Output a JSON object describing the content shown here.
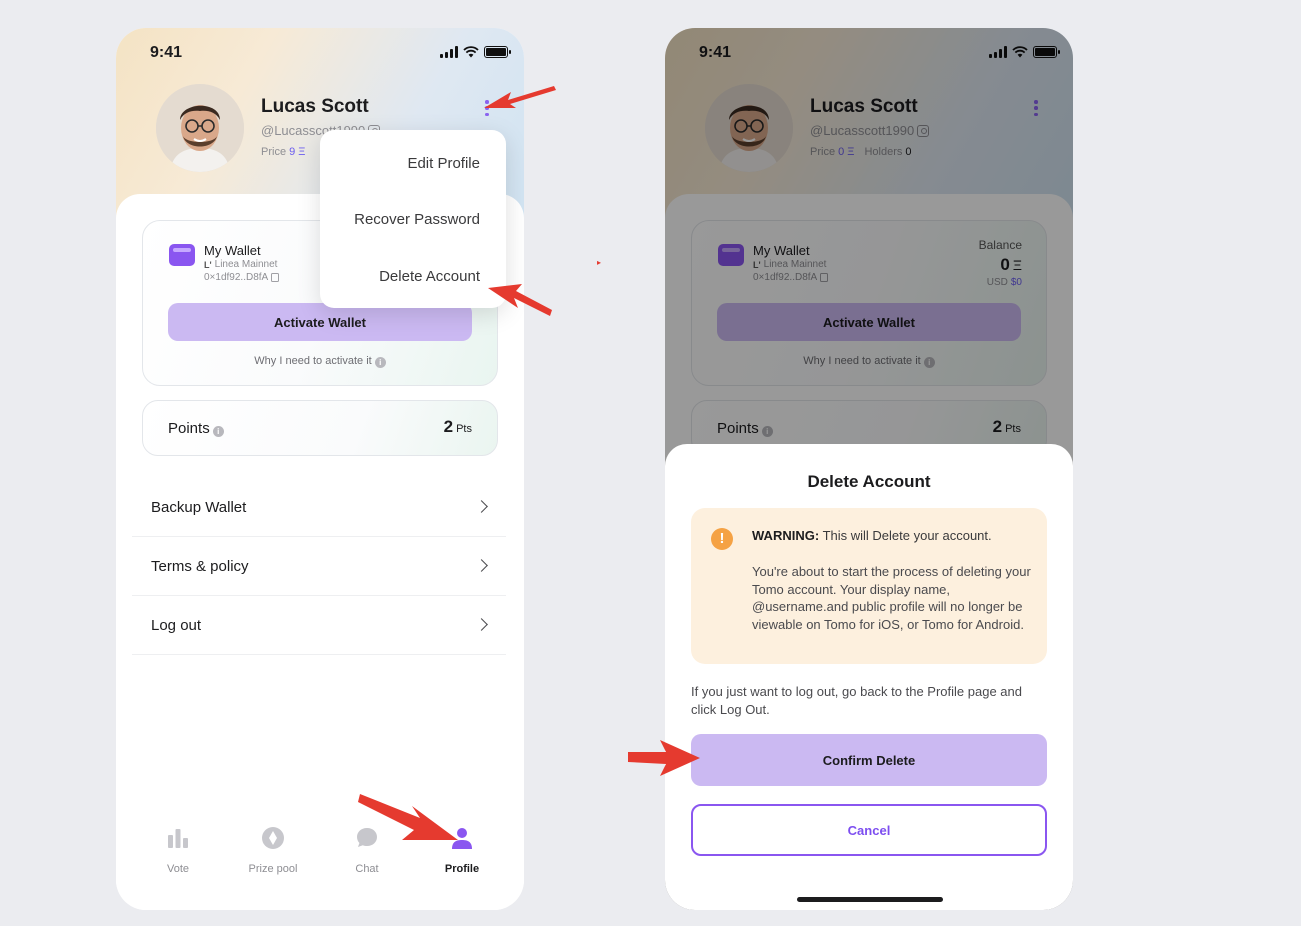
{
  "status": {
    "time": "9:41"
  },
  "profile": {
    "name": "Lucas Scott",
    "handle_left": "@Lucasscott1990",
    "handle_right": "@Lucasscott1990",
    "price_label": "Price",
    "price_value_left": "9 Ξ",
    "price_value_right": "0 Ξ",
    "holders_label": "Holders",
    "holders_value": "0"
  },
  "dropdown": {
    "items": [
      "Edit Profile",
      "Recover Password",
      "Delete Account"
    ]
  },
  "wallet": {
    "name": "My Wallet",
    "network_mark": "L'",
    "network": "Linea Mainnet",
    "address": "0×1df92..D8fA",
    "balance_label": "Balance",
    "balance_value": "0",
    "balance_unit": "Ξ",
    "usd_label": "USD",
    "usd_value": "$0",
    "activate_label": "Activate Wallet",
    "why_text": "Why I need to activate it"
  },
  "points": {
    "label": "Points",
    "value": "2",
    "unit": "Pts"
  },
  "menu": [
    {
      "label": "Backup Wallet"
    },
    {
      "label": "Terms & policy"
    },
    {
      "label": "Log out"
    }
  ],
  "tabs": [
    {
      "label": "Vote",
      "icon": "vote-icon"
    },
    {
      "label": "Prize pool",
      "icon": "prize-pool-icon"
    },
    {
      "label": "Chat",
      "icon": "chat-icon"
    },
    {
      "label": "Profile",
      "icon": "profile-icon"
    }
  ],
  "sheet": {
    "title": "Delete Account",
    "warning_icon": "!",
    "warning_prefix": "WARNING:",
    "warning_head": "This will Delete your account.",
    "warning_body": "You're about to start the process of deleting your Tomo account. Your display name, @username.and public profile will no longer be viewable on Tomo for iOS, or Tomo for Android.",
    "note": "If you just want to log out, go back to the Profile page and click Log Out.",
    "confirm_label": "Confirm Delete",
    "cancel_label": "Cancel"
  },
  "colors": {
    "accent": "#8a56f0",
    "button_fill": "#cbb9f2",
    "warning_bg": "#fdf0de",
    "warning_icon": "#f5a244",
    "annotation_arrow": "#e53a2f"
  }
}
